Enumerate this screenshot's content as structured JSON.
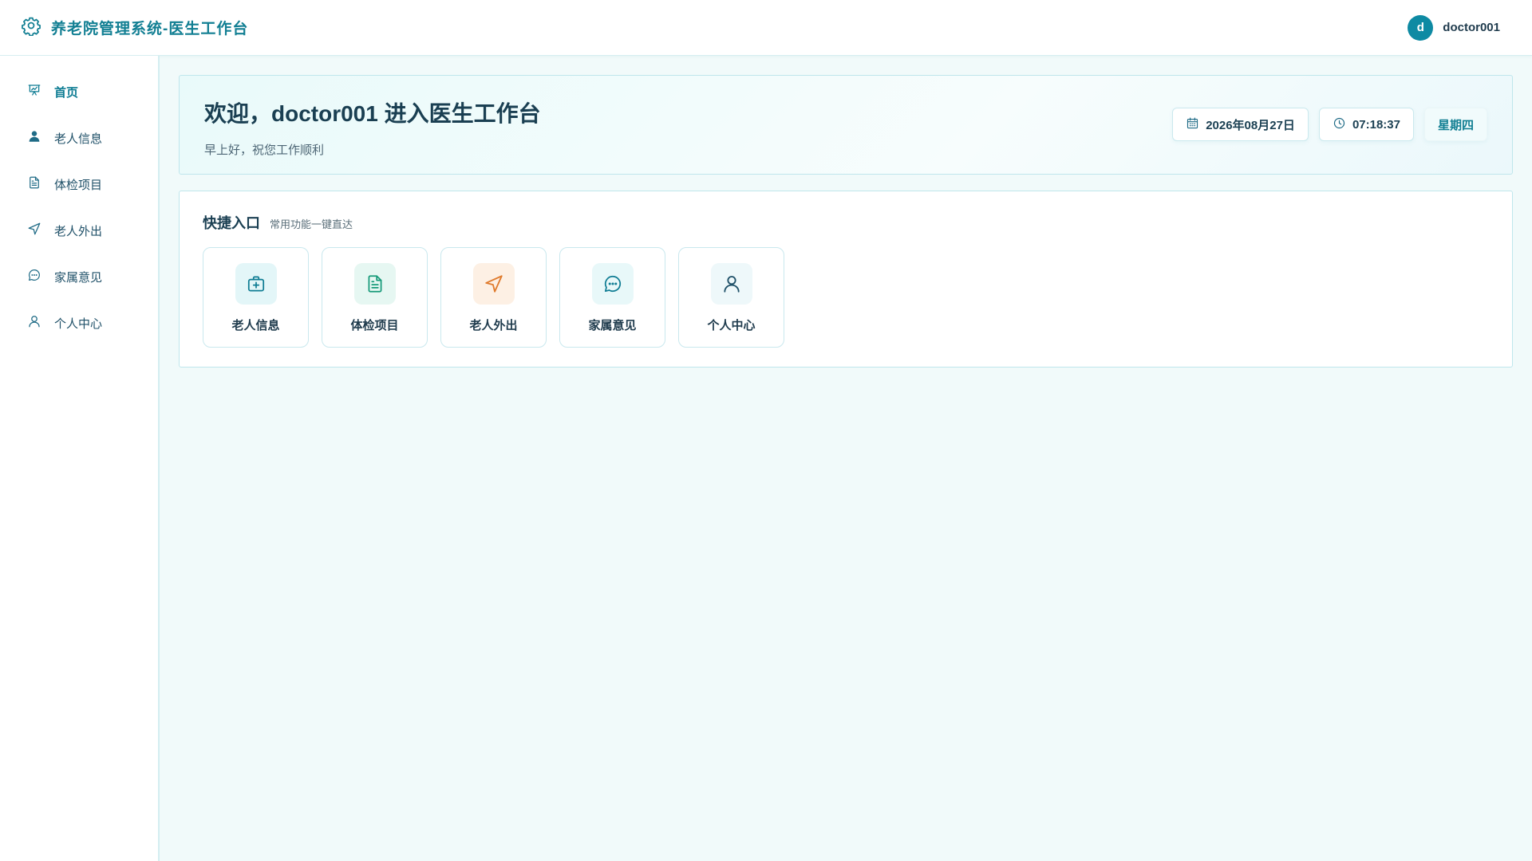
{
  "app": {
    "title": "养老院管理系统-医生工作台",
    "user": {
      "avatar_letter": "d",
      "name": "doctor001"
    }
  },
  "sidebar": {
    "items": [
      {
        "label": "首页",
        "icon": "presentation-chart-icon",
        "active": true
      },
      {
        "label": "老人信息",
        "icon": "user-solid-icon",
        "active": false
      },
      {
        "label": "体检项目",
        "icon": "document-icon",
        "active": false
      },
      {
        "label": "老人外出",
        "icon": "send-arrow-icon",
        "active": false
      },
      {
        "label": "家属意见",
        "icon": "chat-bubble-icon",
        "active": false
      },
      {
        "label": "个人中心",
        "icon": "user-outline-icon",
        "active": false
      }
    ]
  },
  "welcome": {
    "title": "欢迎，doctor001 进入医生工作台",
    "subtitle": "早上好，祝您工作顺利",
    "date": "2026年08月27日",
    "time": "07:18:37",
    "weekday": "星期四"
  },
  "quick": {
    "title": "快捷入口",
    "subtitle": "常用功能一键直达",
    "tiles": [
      {
        "label": "老人信息",
        "icon": "medical-kit-icon",
        "bg": "#e3f6f8",
        "color": "#0e7c93"
      },
      {
        "label": "体检项目",
        "icon": "document-icon",
        "bg": "#e6f7f2",
        "color": "#169a79"
      },
      {
        "label": "老人外出",
        "icon": "send-arrow-icon",
        "bg": "#fdf0e4",
        "color": "#e07b2d"
      },
      {
        "label": "家属意见",
        "icon": "chat-bubble-icon",
        "bg": "#e8f8f9",
        "color": "#0e7c93"
      },
      {
        "label": "个人中心",
        "icon": "user-outline-icon",
        "bg": "#eef8fa",
        "color": "#1f5068"
      }
    ]
  },
  "colors": {
    "accent": "#0e7c93",
    "avatar_bg": "#0e8aa3",
    "page_bg": "#f1fafa",
    "border": "#bfe6ec"
  }
}
